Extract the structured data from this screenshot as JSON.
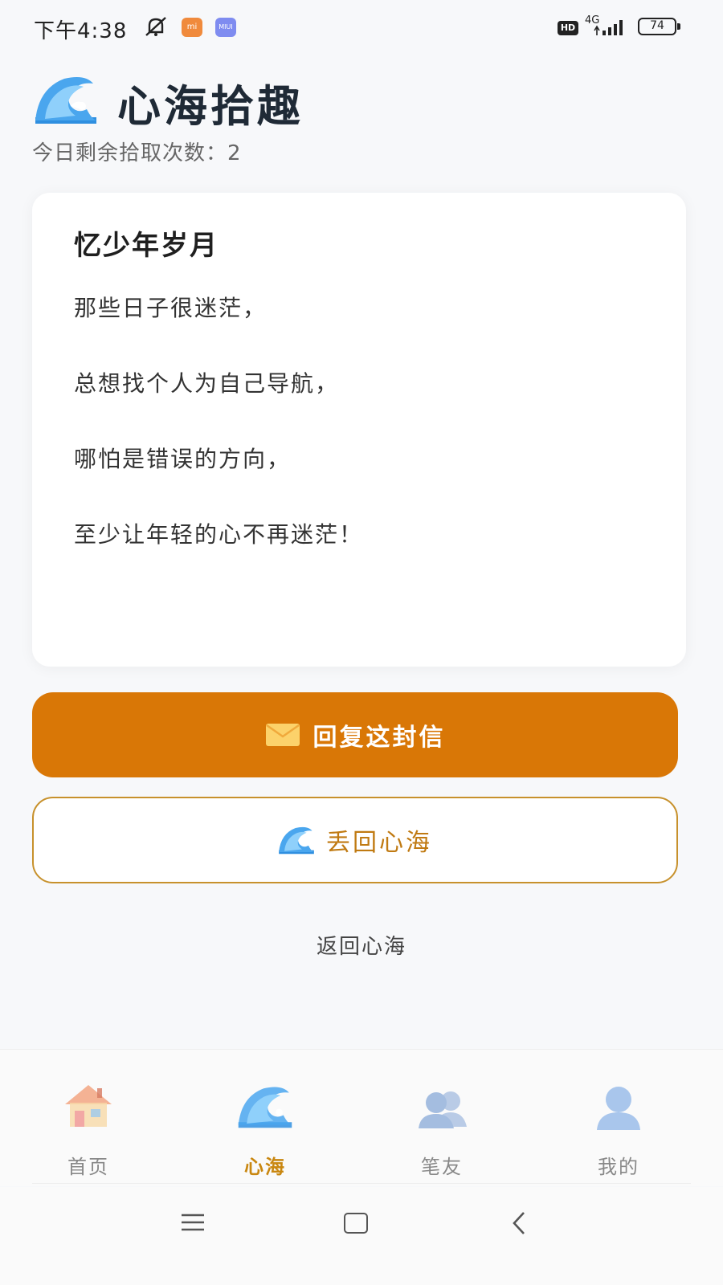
{
  "status_bar": {
    "time": "下午4:38",
    "network": "4G",
    "hd": "HD",
    "battery": "74",
    "app1_icon": "mi-store-icon",
    "app2_icon": "miui-icon",
    "app2_label": "MIUI"
  },
  "header": {
    "title": "心海拾趣",
    "remaining": "今日剩余拾取次数：2",
    "icon": "wave-icon"
  },
  "letter": {
    "title": "忆少年岁月",
    "lines": [
      "那些日子很迷茫，",
      "总想找个人为自己导航，",
      "哪怕是错误的方向，",
      "至少让年轻的心不再迷茫！"
    ]
  },
  "actions": {
    "reply_label": "回复这封信",
    "throw_label": "丢回心海",
    "back_label": "返回心海"
  },
  "tabs": [
    {
      "label": "首页",
      "icon": "house-icon",
      "active": false
    },
    {
      "label": "心海",
      "icon": "wave-icon",
      "active": true
    },
    {
      "label": "笔友",
      "icon": "friends-icon",
      "active": false
    },
    {
      "label": "我的",
      "icon": "user-icon",
      "active": false
    }
  ],
  "colors": {
    "accent": "#d97706",
    "accent_text": "#c07a12",
    "wave_blue": "#3b9be6"
  }
}
